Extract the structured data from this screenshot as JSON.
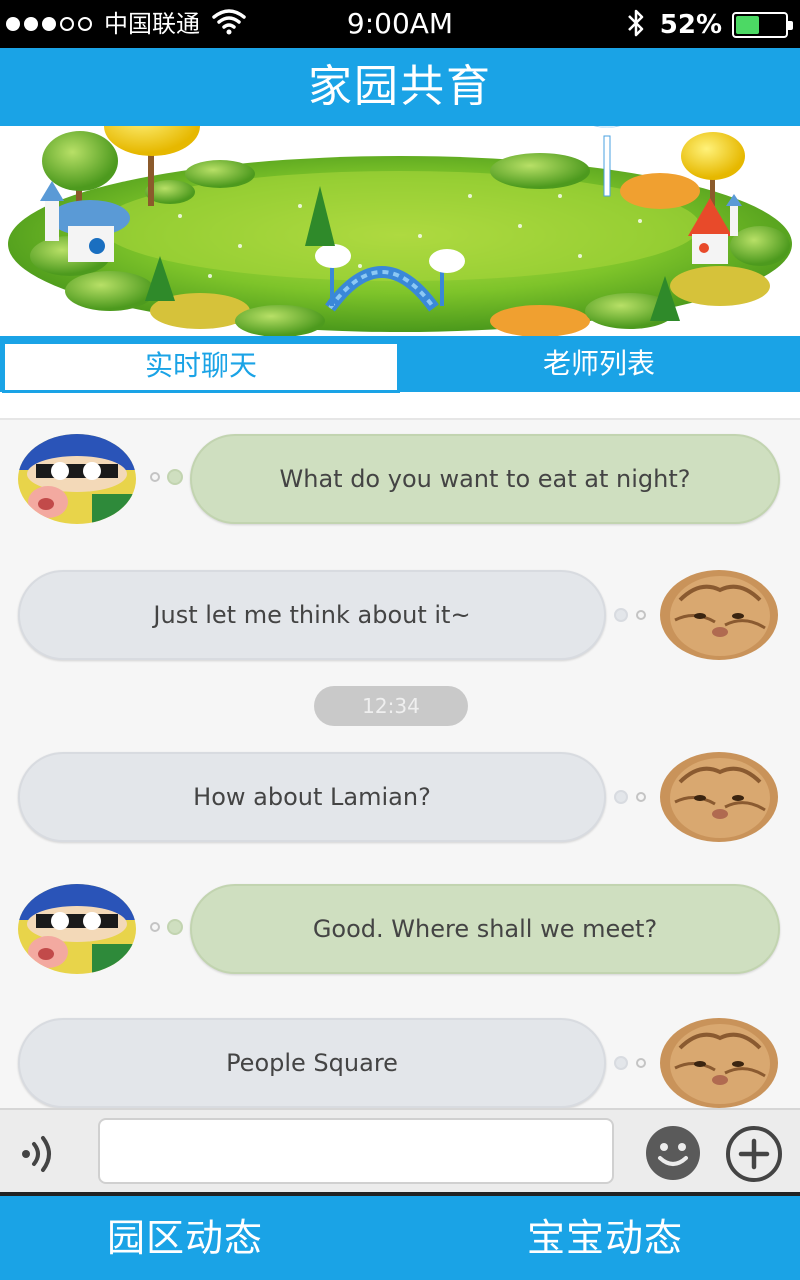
{
  "status_bar": {
    "carrier": "中国联通",
    "time": "9:00AM",
    "battery_percent": "52%",
    "battery_level": 0.52,
    "signal_dots_filled": 3,
    "signal_dots_total": 5
  },
  "header": {
    "title": "家园共育"
  },
  "banner": {
    "image": "kindergarten-park-illustration"
  },
  "tabs": [
    {
      "label": "实时聊天",
      "active": true
    },
    {
      "label": "老师列表",
      "active": false
    }
  ],
  "chat": {
    "messages": [
      {
        "side": "left",
        "avatar": "cartoon-kid-avatar",
        "text": "What do you want to eat at night?",
        "bubble_color": "#cfdfc0"
      },
      {
        "side": "right",
        "avatar": "cat-avatar",
        "text": "Just let me think about it~",
        "bubble_color": "#e3e6ea"
      },
      {
        "side": "right",
        "avatar": "cat-avatar",
        "text": "How about Lamian?",
        "bubble_color": "#e3e6ea"
      },
      {
        "side": "left",
        "avatar": "cartoon-kid-avatar",
        "text": "Good. Where shall we meet?",
        "bubble_color": "#cfdfc0"
      },
      {
        "side": "right",
        "avatar": "cat-avatar",
        "text": "People Square",
        "bubble_color": "#e3e6ea"
      }
    ],
    "timestamp": "12:34"
  },
  "input_bar": {
    "value": "",
    "placeholder": "",
    "voice_icon": "voice-icon",
    "emoji_icon": "smiley-icon",
    "more_icon": "plus-icon"
  },
  "bottom_nav": {
    "left": "园区动态",
    "right": "宝宝动态"
  },
  "colors": {
    "brand_blue": "#1aa3e6",
    "status_bar": "#000000",
    "battery_green": "#4cd964"
  }
}
